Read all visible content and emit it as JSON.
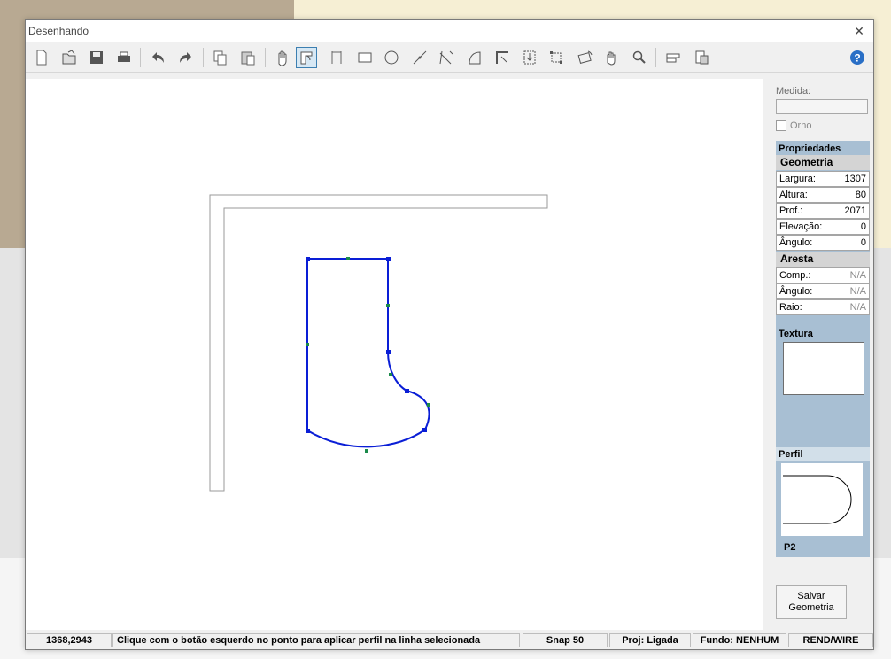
{
  "window": {
    "title": "Desenhando"
  },
  "toolbar": {
    "tools": [
      {
        "icon": "new-file-icon"
      },
      {
        "icon": "open-folder-icon"
      },
      {
        "icon": "save-disk-icon"
      },
      {
        "icon": "print-icon"
      },
      {
        "icon": "undo-icon"
      },
      {
        "icon": "redo-icon"
      },
      {
        "icon": "copy-icon"
      },
      {
        "icon": "paste-icon"
      },
      {
        "icon": "hand-pan-icon"
      },
      {
        "icon": "apply-profile-icon",
        "active": true
      },
      {
        "icon": "bracket-shape-icon"
      },
      {
        "icon": "rectangle-icon"
      },
      {
        "icon": "circle-icon"
      },
      {
        "icon": "line-icon"
      },
      {
        "icon": "trim-icon"
      },
      {
        "icon": "arc-icon"
      },
      {
        "icon": "corner-icon"
      },
      {
        "icon": "import-icon"
      },
      {
        "icon": "resize-frame-icon"
      },
      {
        "icon": "rotate-icon"
      },
      {
        "icon": "hand-move-icon"
      },
      {
        "icon": "zoom-icon"
      },
      {
        "icon": "layers-icon"
      },
      {
        "icon": "properties-icon"
      },
      {
        "icon": "help-icon"
      }
    ]
  },
  "panel": {
    "medida_label": "Medida:",
    "medida_value": "",
    "orho_label": "Orho",
    "orho_checked": false,
    "properties_title": "Propriedades",
    "geometria": {
      "title": "Geometria",
      "rows": [
        {
          "label": "Largura:",
          "value": "1307"
        },
        {
          "label": "Altura:",
          "value": "80"
        },
        {
          "label": "Prof.:",
          "value": "2071"
        },
        {
          "label": "Elevação:",
          "value": "0"
        },
        {
          "label": "Ângulo:",
          "value": "0"
        }
      ]
    },
    "aresta": {
      "title": "Aresta",
      "rows": [
        {
          "label": "Comp.:",
          "value": "N/A"
        },
        {
          "label": "Ângulo:",
          "value": "N/A"
        },
        {
          "label": "Raio:",
          "value": "N/A"
        }
      ]
    },
    "textura_title": "Textura",
    "perfil_title": "Perfil",
    "perfil_name": "P2",
    "save_button": "Salvar\nGeometria"
  },
  "statusbar": {
    "coords": "1368,2943",
    "message": "Clique com o botão esquerdo no ponto para aplicar perfil na linha selecionada",
    "snap": "Snap 50",
    "proj": "Proj: Ligada",
    "fundo": "Fundo: NENHUM",
    "render": "REND/WIRE"
  },
  "colors": {
    "selection_blue": "#0a1ed6",
    "midpoint_green": "#1a8a4a",
    "panel_blue": "#a8bfd3"
  }
}
